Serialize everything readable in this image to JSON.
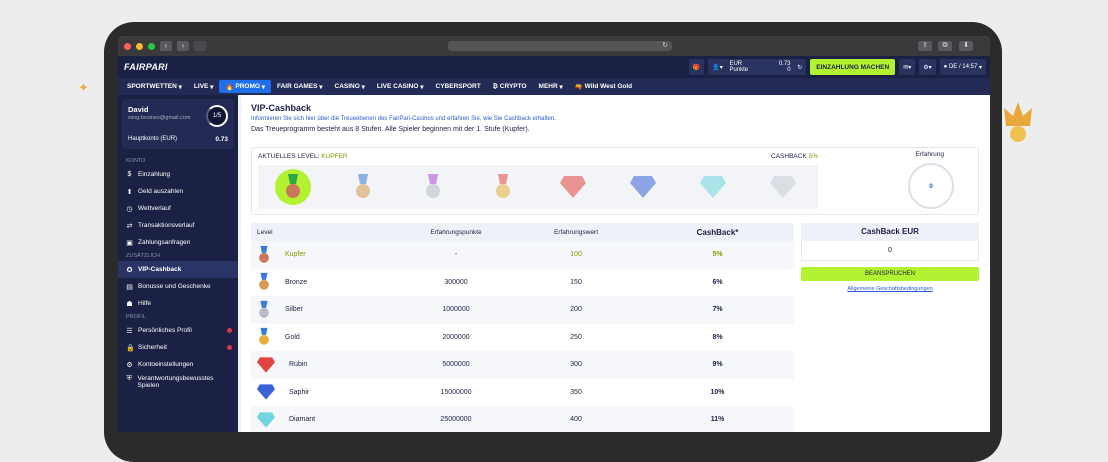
{
  "header": {
    "logo": "FAIRPARI",
    "balance_currency": "EUR",
    "balance_value": "0.73",
    "points_label": "Punkte",
    "points_value": "0",
    "deposit_button": "EINZAHLUNG MACHEN",
    "language_time": "DE / 14:57"
  },
  "menu": [
    "SPORTWETTEN",
    "LIVE",
    "PROMO",
    "FAIR GAMES",
    "CASINO",
    "LIVE CASINO",
    "CYBERSPORT",
    "CRYPTO",
    "MEHR",
    "Wild West Gold"
  ],
  "user": {
    "name": "David",
    "email": "wing.bosines@gmail.com",
    "level_progress": "1/5",
    "account_label": "Hauptkonto (EUR)",
    "account_value": "0.73"
  },
  "sidebar": {
    "section_konto": "KONTO",
    "konto_items": [
      "Einzahlung",
      "Geld auszahlen",
      "Wettverlauf",
      "Transaktionsverlauf",
      "Zahlungsanfragen"
    ],
    "section_zusaetzlich": "ZUSÄTZLICH",
    "zusaetzlich_items": [
      "VIP-Cashback",
      "Bonusse und Geschenke",
      "Hilfe"
    ],
    "section_profil": "PROFIL",
    "profil_items": [
      "Persönliches Profil",
      "Sicherheit",
      "Kontoeinstellungen",
      "Verantwortungsbewusstes Spielen"
    ]
  },
  "page": {
    "title": "VIP-Cashback",
    "subtitle": "Informieren Sie sich hier über die Treueebenen des FairPari-Casinos und erfahren Sie, wie Sie Cashback erhalten.",
    "intro": "Das Treueprogramm besteht aus 8 Stufen. Alle Spieler beginnen mit der 1. Stufe (Kupfer).",
    "current_level_label": "AKTUELLES LEVEL:",
    "current_level_value": "KUPFER",
    "cashback_label": "CASHBACK",
    "cashback_value": "5%",
    "experience_label": "Erfahrung",
    "experience_value": "0"
  },
  "table": {
    "headers": [
      "Level",
      "Erfahrungspunkte",
      "Erfahrungswert",
      "CashBack*"
    ],
    "rows": [
      {
        "level": "Kupfer",
        "points": "-",
        "value": "100",
        "cashback": "5%",
        "icon": "copper-medal-icon",
        "color": "#c9785a"
      },
      {
        "level": "Bronze",
        "points": "300000",
        "value": "150",
        "cashback": "6%",
        "icon": "bronze-medal-icon",
        "color": "#d49a52"
      },
      {
        "level": "Silber",
        "points": "1000000",
        "value": "200",
        "cashback": "7%",
        "icon": "silver-medal-icon",
        "color": "#b8bcc8"
      },
      {
        "level": "Gold",
        "points": "2000000",
        "value": "250",
        "cashback": "8%",
        "icon": "gold-medal-icon",
        "color": "#e8b23a"
      },
      {
        "level": "Rubin",
        "points": "5000000",
        "value": "300",
        "cashback": "9%",
        "icon": "ruby-gem-icon",
        "color": "#e0463f"
      },
      {
        "level": "Saphir",
        "points": "15000000",
        "value": "350",
        "cashback": "10%",
        "icon": "sapphire-gem-icon",
        "color": "#3a63d8"
      },
      {
        "level": "Diamant",
        "points": "25000000",
        "value": "400",
        "cashback": "11%",
        "icon": "diamond-gem-icon",
        "color": "#6fd6e0"
      }
    ]
  },
  "cashback_panel": {
    "title": "CashBack EUR",
    "value": "0",
    "button": "BEANSPRUCHEN",
    "terms_link": "Allgemeine Geschäftsbedingungen"
  },
  "colors": {
    "navy": "#1a2144",
    "accent_green": "#b3f230",
    "accent_blue": "#1f6feb"
  }
}
